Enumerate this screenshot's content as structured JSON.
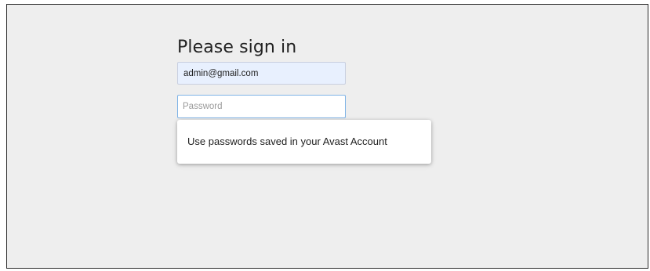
{
  "form": {
    "title": "Please sign in",
    "email_value": "admin@gmail.com",
    "password_placeholder": "Password"
  },
  "autofill_popup": {
    "label": "Use passwords saved in your Avast Account"
  },
  "colors": {
    "page_background": "#eeeeee",
    "autofilled_field": "#e8f0fe",
    "focus_border": "#7fb3e6"
  }
}
